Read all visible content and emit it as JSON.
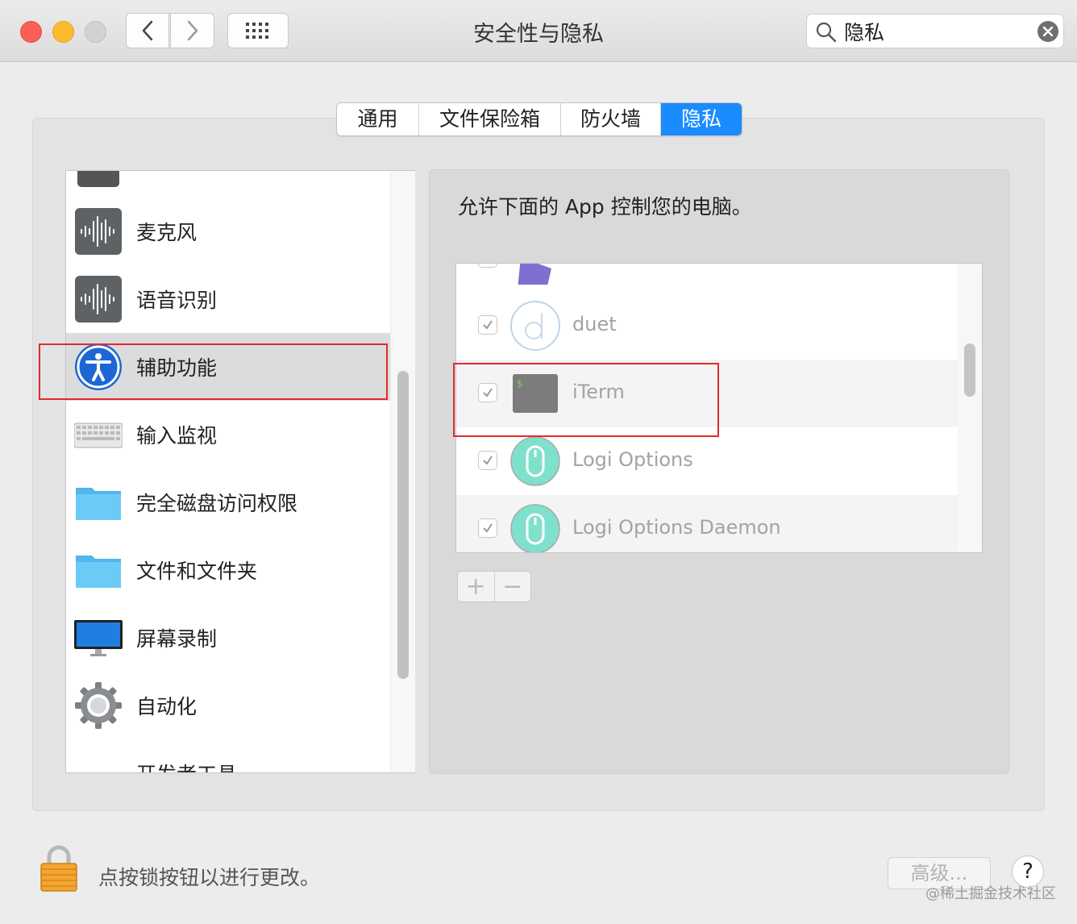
{
  "window": {
    "title": "安全性与隐私"
  },
  "search": {
    "value": "隐私"
  },
  "tabs": [
    {
      "label": "通用",
      "active": false
    },
    {
      "label": "文件保险箱",
      "active": false
    },
    {
      "label": "防火墙",
      "active": false
    },
    {
      "label": "隐私",
      "active": true
    }
  ],
  "sidebar": {
    "items": [
      {
        "label": "麦克风",
        "icon": "microphone-waveform-icon"
      },
      {
        "label": "语音识别",
        "icon": "speech-waveform-icon"
      },
      {
        "label": "辅助功能",
        "icon": "accessibility-icon",
        "selected": true
      },
      {
        "label": "输入监视",
        "icon": "keyboard-icon"
      },
      {
        "label": "完全磁盘访问权限",
        "icon": "folder-icon"
      },
      {
        "label": "文件和文件夹",
        "icon": "folder-icon"
      },
      {
        "label": "屏幕录制",
        "icon": "display-icon"
      },
      {
        "label": "自动化",
        "icon": "gear-icon"
      },
      {
        "label": "开发者工具",
        "icon": ""
      }
    ]
  },
  "main": {
    "prompt": "允许下面的 App 控制您的电脑。",
    "apps": [
      {
        "name": "duet",
        "checked": true,
        "icon": "duet-icon"
      },
      {
        "name": "iTerm",
        "checked": true,
        "icon": "terminal-icon"
      },
      {
        "name": "Logi Options",
        "checked": true,
        "icon": "mouse-icon"
      },
      {
        "name": "Logi Options Daemon",
        "checked": true,
        "icon": "mouse-icon"
      }
    ],
    "add_label": "+",
    "remove_label": "−"
  },
  "footer": {
    "lock_text": "点按锁按钮以进行更改。",
    "advanced_label": "高级...",
    "help_label": "?",
    "watermark": "@稀土掘金技术社区"
  },
  "colors": {
    "accent": "#1a8cff",
    "highlight_box": "#e02b2b"
  }
}
